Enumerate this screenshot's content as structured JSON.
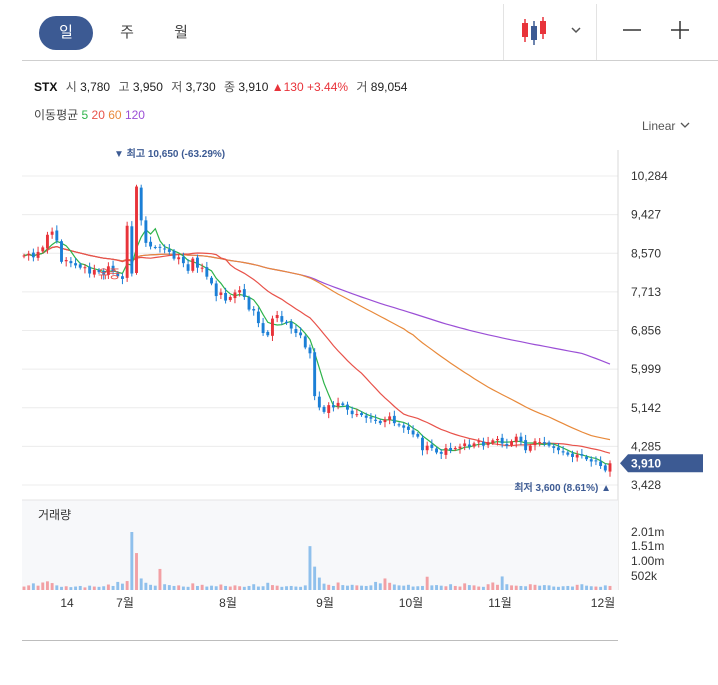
{
  "tabs": [
    {
      "label": "일",
      "active": true
    },
    {
      "label": "주",
      "active": false
    },
    {
      "label": "월",
      "active": false
    }
  ],
  "ticker": "STX",
  "quote": {
    "open_label": "시",
    "open": "3,780",
    "high_label": "고",
    "high": "3,950",
    "low_label": "저",
    "low": "3,730",
    "close_label": "종",
    "close": "3,910",
    "change": "▲130",
    "change_pct": "+3.44%",
    "volume_label": "거",
    "volume": "89,054"
  },
  "ma_legend": {
    "label": "이동평균",
    "ma5": "5",
    "ma20": "20",
    "ma60": "60",
    "ma120": "120"
  },
  "scale_button": "Linear",
  "colors": {
    "up": "#e8333a",
    "down": "#1b7fd6",
    "accent": "#3c5a93",
    "ma5": "#2db34a",
    "ma20": "#e8524a",
    "ma60": "#e8893a",
    "ma120": "#9b4fd6"
  },
  "chart_data": {
    "type": "candlestick",
    "y_ticks": [
      "10,284",
      "9,427",
      "8,570",
      "7,713",
      "6,856",
      "5,999",
      "5,142",
      "4,285",
      "3,428"
    ],
    "y_range": [
      3428,
      10284
    ],
    "x_ticks": [
      "14",
      "7월",
      "8월",
      "9월",
      "10월",
      "11월",
      "12월"
    ],
    "current_price": "3,910",
    "high_annotation": "▼ 최고 10,650 (-63.29%)",
    "low_annotation": "최저 3,600 (8.61%) ▲",
    "event_label": "유증",
    "volume_title": "거래량",
    "volume_ticks": [
      "2.01m",
      "1.51m",
      "1.00m",
      "502k"
    ],
    "close_series": [
      8520,
      8560,
      8480,
      8600,
      8700,
      8980,
      9050,
      8850,
      8380,
      8420,
      8350,
      8300,
      8250,
      8260,
      8120,
      8200,
      8150,
      8100,
      8280,
      8160,
      8060,
      8000,
      9180,
      8120,
      10050,
      9300,
      8800,
      8720,
      8700,
      8700,
      8660,
      8600,
      8450,
      8480,
      8350,
      8180,
      8450,
      8250,
      8250,
      8050,
      7900,
      7620,
      7700,
      7520,
      7600,
      7700,
      7750,
      7600,
      7320,
      7300,
      7020,
      6800,
      6750,
      7120,
      7200,
      7050,
      7020,
      6900,
      6800,
      6750,
      6480,
      6350,
      5400,
      5150,
      5050,
      5200,
      5150,
      5250,
      5200,
      5100,
      5000,
      5000,
      4980,
      4920,
      4900,
      4850,
      4800,
      4880,
      4950,
      4800,
      4750,
      4700,
      4650,
      4550,
      4500,
      4200,
      4300,
      4250,
      4150,
      4120,
      4250,
      4200,
      4250,
      4280,
      4350,
      4280,
      4350,
      4400,
      4300,
      4380,
      4420,
      4450,
      4350,
      4300,
      4400,
      4500,
      4400,
      4200,
      4300,
      4400,
      4380,
      4350,
      4300,
      4250,
      4200,
      4150,
      4100,
      4050,
      4100,
      4080,
      4000,
      3950,
      3960,
      3850,
      3750,
      3910
    ],
    "volume_k": [
      120,
      160,
      230,
      150,
      260,
      300,
      240,
      160,
      110,
      130,
      100,
      120,
      140,
      90,
      150,
      120,
      110,
      130,
      190,
      140,
      280,
      220,
      310,
      2010,
      1280,
      400,
      250,
      180,
      150,
      730,
      200,
      170,
      140,
      160,
      120,
      110,
      230,
      140,
      180,
      120,
      150,
      130,
      190,
      140,
      120,
      160,
      130,
      110,
      140,
      200,
      120,
      130,
      250,
      170,
      150,
      110,
      130,
      140,
      120,
      110,
      160,
      1520,
      810,
      430,
      220,
      180,
      140,
      260,
      170,
      150,
      180,
      160,
      150,
      140,
      160,
      280,
      230,
      400,
      250,
      190,
      160,
      150,
      180,
      120,
      130,
      140,
      460,
      160,
      170,
      150,
      130,
      200,
      140,
      120,
      230,
      170,
      160,
      120,
      110,
      200,
      260,
      180,
      470,
      200,
      160,
      150,
      140,
      130,
      200,
      180,
      150,
      170,
      160,
      120,
      110,
      130,
      140,
      120,
      180,
      200,
      150,
      130,
      120,
      110,
      160,
      140
    ]
  }
}
